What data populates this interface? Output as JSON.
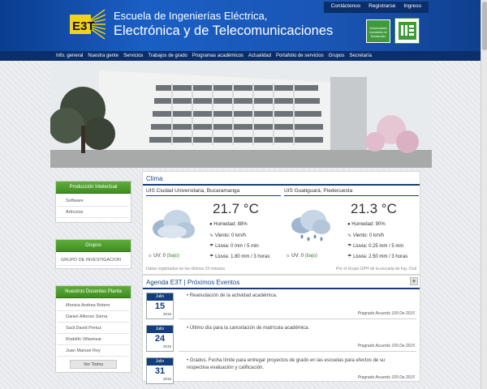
{
  "header": {
    "top_links": [
      "Contáctenos",
      "Registrarse",
      "Ingreso"
    ],
    "school_line1": "Escuela de Ingenierías Eléctrica,",
    "school_line2": "Electrónica y de Telecomunicaciones",
    "uis_badge_text": "Universidad Industrial de Santander",
    "logo_text": "E3T"
  },
  "nav": [
    "Info. general",
    "Nuestra gente",
    "Servicios",
    "Trabajos de grado",
    "Programas académicos",
    "Actualidad",
    "Portafolio de servicios",
    "Grupos",
    "Secretaría"
  ],
  "sidebar": {
    "produccion": {
      "title": "Producción Intelectual",
      "items": [
        "Software",
        "Artículos"
      ]
    },
    "grupos": {
      "title": "Grupos",
      "items": [
        "GRUPO DE INVESTIGACION"
      ]
    },
    "docentes": {
      "title": "Nuestros Docentes Planta",
      "items": [
        "Monica Andrea Botero",
        "Daniel Alfonso Sierra",
        "Saúl David Pertuz",
        "Rodolfo Villamizar",
        "Juan Manuel Rey"
      ],
      "button": "Ver Todos"
    }
  },
  "clima": {
    "title": "Clima",
    "stations": [
      {
        "location": "UIS Ciudad Universitaria, Bucaramanga",
        "temp": "21.7 °C",
        "humedad": "Humedad: 88%",
        "viento": "Viento: 0 km/h",
        "lluvia1": "Lluvia: 0 mm / 5 min",
        "lluvia2": "Lluvia: 1.80 mm / 3 horas",
        "uv_label": "UV: 0",
        "uv_level": "(bajo)"
      },
      {
        "location": "UIS Guatiguará, Piedecuesta",
        "temp": "21.3 °C",
        "humedad": "Humedad: 90%",
        "viento": "Viento: 0 km/h",
        "lluvia1": "Lluvia: 0.25 mm / 5 min",
        "lluvia2": "Lluvia: 2.50 mm / 3 horas",
        "uv_label": "UV: 0",
        "uv_level": "(bajo)"
      }
    ],
    "footer_left": "Datos registrados en los últimos 15 minutos",
    "footer_right": "Por el Grupo GPH de la escuela de Ing. Civil"
  },
  "agenda": {
    "title": "Agenda E3T | Próximos Eventos",
    "plus": "+",
    "events": [
      {
        "month": "Julio",
        "day": "15",
        "year": "2015",
        "text": "Reanudación de la actividad académica.",
        "by": "Pregrado Acuerdo 109 De 2015"
      },
      {
        "month": "Julio",
        "day": "24",
        "year": "2015",
        "text": "Último día para la cancelación de matrícula académica.",
        "by": "Pregrado Acuerdo 109 De 2015"
      },
      {
        "month": "Julio",
        "day": "31",
        "year": "2015",
        "text": "Grados. Fecha límite para entregar proyectos de grado en las escuelas para efectos de su respectiva evaluación y calificación.",
        "by": "Pregrado Acuerdo 109 De 2015"
      }
    ]
  },
  "colors": {
    "header_blue": "#1a55b3",
    "nav_dark": "#0b2f6b",
    "green": "#4a9d2c"
  }
}
